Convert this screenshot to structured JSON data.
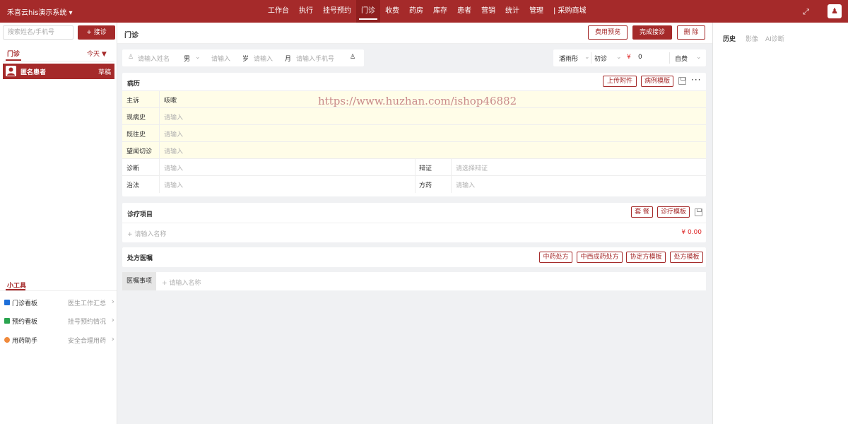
{
  "app": {
    "title": "禾喜云his演示系统",
    "dropdown_icon": "caret-down-icon"
  },
  "nav": [
    {
      "label": "工作台"
    },
    {
      "label": "执行"
    },
    {
      "label": "挂号预约"
    },
    {
      "label": "门诊",
      "active": true
    },
    {
      "label": "收费"
    },
    {
      "label": "药房"
    },
    {
      "label": "库存"
    },
    {
      "label": "患者"
    },
    {
      "label": "营销"
    },
    {
      "label": "统计"
    },
    {
      "label": "管理"
    },
    {
      "label": "| 采购商城"
    }
  ],
  "left": {
    "search_placeholder": "搜索姓名/手机号",
    "receive_button": "+ 接诊",
    "tab_label": "门诊",
    "date_filter": "今天 ▼",
    "patients": [
      {
        "name": "匿名患者",
        "status": "草稿"
      }
    ],
    "tools_title": "小工具",
    "tools": [
      {
        "label": "门诊看板",
        "hint": "医生工作汇总",
        "color": "#1e6fd9"
      },
      {
        "label": "预约看板",
        "hint": "挂号预约情况",
        "color": "#2aa44f"
      },
      {
        "label": "用药助手",
        "hint": "安全合理用药",
        "color": "#f08a3c"
      }
    ]
  },
  "main": {
    "title": "门诊",
    "buttons": {
      "preview": "费用预览",
      "complete": "完成接诊",
      "delete": "删 除"
    },
    "patient": {
      "name_placeholder": "请输入姓名",
      "gender": "男",
      "age_placeholder": "请输入",
      "age_unit": "岁",
      "month_placeholder": "请输入",
      "month_unit": "月",
      "phone_placeholder": "请输入手机号"
    },
    "visit": {
      "doctor": "潘雨彤",
      "visit_type": "初诊",
      "currency": "¥",
      "fee": "0",
      "pay_type": "自费"
    },
    "record": {
      "title": "病历",
      "upload_button": "上传附件",
      "template_button": "病例模版",
      "rows": [
        {
          "label": "主诉",
          "value": "咳嗽"
        },
        {
          "label": "现病史",
          "placeholder": "请输入"
        },
        {
          "label": "既往史",
          "placeholder": "请输入"
        },
        {
          "label": "望闻切诊",
          "placeholder": "请输入"
        }
      ],
      "diagnosis": {
        "label": "诊断",
        "placeholder": "请输入",
        "label2": "辩证",
        "placeholder2": "请选择辩证"
      },
      "treatment": {
        "label": "治法",
        "placeholder": "请输入",
        "label2": "方药",
        "placeholder2": "请输入"
      }
    },
    "watermark": "https://www.huzhan.com/ishop46882",
    "items": {
      "title": "诊疗项目",
      "package_button": "套 餐",
      "template_button": "诊疗模板",
      "add_placeholder": "+ 请输入名称",
      "total": "¥ 0.00"
    },
    "prescription": {
      "title": "处方医嘱",
      "buttons": [
        "中药处方",
        "中西成药处方",
        "协定方模板",
        "处方模板"
      ],
      "advice_label": "医嘱事项",
      "advice_placeholder": "+ 请输入名称"
    }
  },
  "right": {
    "tabs": [
      "历史",
      "影像",
      "AI诊断"
    ]
  },
  "colors": {
    "brand": "#a52a2a",
    "record_bg": "#fffde8",
    "price": "#dd2222"
  }
}
